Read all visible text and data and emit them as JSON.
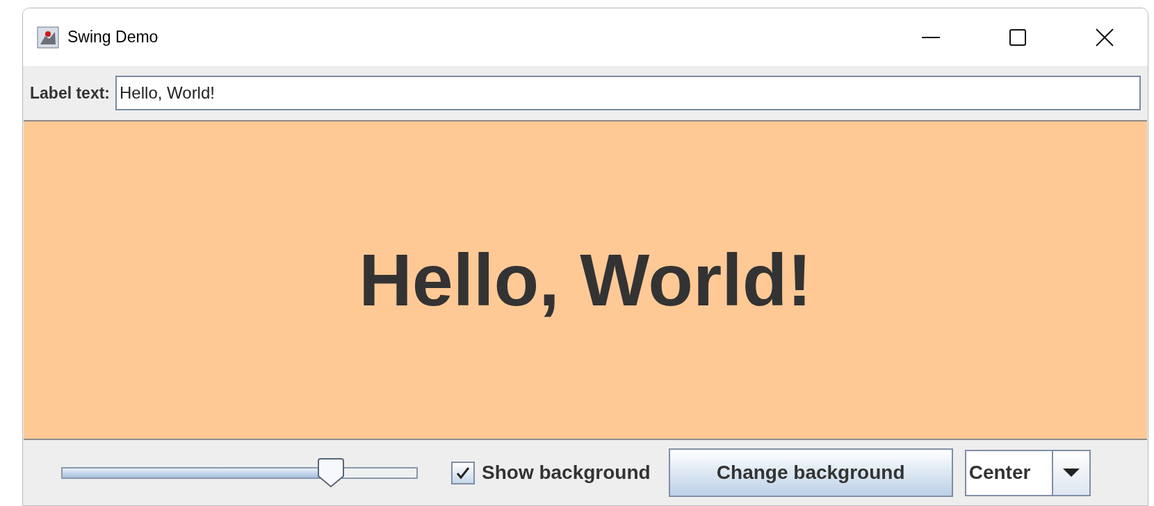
{
  "window": {
    "title": "Swing Demo"
  },
  "label_field": {
    "label": "Label text:",
    "value": "Hello, World!"
  },
  "display": {
    "text": "Hello, World!"
  },
  "controls": {
    "slider": {
      "level": 0.756
    },
    "show_background": {
      "label": "Show background",
      "checked": true
    },
    "change_button": "Change background",
    "alignment": {
      "value": "Center"
    }
  }
}
